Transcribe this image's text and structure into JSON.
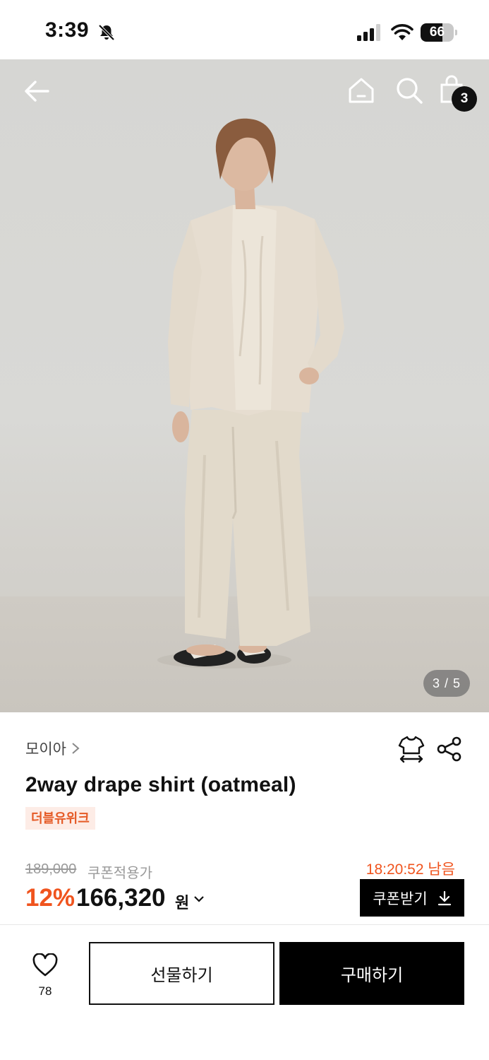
{
  "status_bar": {
    "time": "3:39",
    "battery": "66",
    "battery_level": 0.66,
    "icons": [
      "bell-slash-icon",
      "signal-icon",
      "wifi-icon",
      "battery-icon"
    ]
  },
  "header": {
    "icons": [
      "back-arrow-icon",
      "home-icon",
      "search-icon",
      "shopping-bag-icon"
    ],
    "cart_count": "3"
  },
  "gallery": {
    "page_indicator": "3 / 5",
    "current": 3,
    "total": 5
  },
  "product": {
    "brand": "모이아",
    "name": "2way drape shirt (oatmeal)",
    "tag": "더블유위크",
    "original_price": "189,000",
    "coupon_label": "쿠폰적용가",
    "discount": "12%",
    "price": "166,320",
    "currency": "원",
    "timer": "18:20:52 남음",
    "coupon_button": "쿠폰받기"
  },
  "actions": {
    "like_count": "78",
    "gift_button": "선물하기",
    "buy_button": "구매하기"
  },
  "colors": {
    "accent": "#f0541e",
    "tag_bg": "#fdece6",
    "primary": "#000000"
  }
}
